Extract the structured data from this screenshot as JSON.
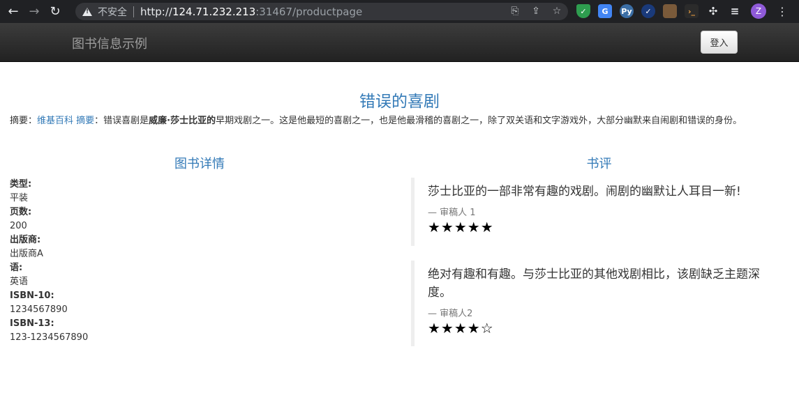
{
  "browser": {
    "back": "←",
    "forward": "→",
    "reload": "↻",
    "security_label": "不安全",
    "url_scheme": "http://",
    "url_host": "124.71.232.213",
    "url_rest": ":31467/productpage",
    "profile_initial": "Z"
  },
  "navbar": {
    "brand": "图书信息示例",
    "login_label": "登入"
  },
  "book": {
    "title": "错误的喜剧",
    "summary_prefix": "摘要：",
    "summary_link": "维基百科 摘要",
    "summary_colon": "：错误喜剧是",
    "summary_bold": "威廉·莎士比亚的",
    "summary_rest": "早期戏剧之一。这是他最短的喜剧之一，也是他最滑稽的喜剧之一，除了双关语和文字游戏外，大部分幽默来自闹剧和错误的身份。"
  },
  "details": {
    "heading": "图书详情",
    "fields": [
      {
        "label": "类型:",
        "value": "平装"
      },
      {
        "label": "页数:",
        "value": "200"
      },
      {
        "label": "出版商:",
        "value": "出版商A"
      },
      {
        "label": "语:",
        "value": "英语"
      },
      {
        "label": "ISBN-10:",
        "value": "1234567890"
      },
      {
        "label": "ISBN-13:",
        "value": "123-1234567890"
      }
    ]
  },
  "reviews": {
    "heading": "书评",
    "items": [
      {
        "text": "莎士比亚的一部非常有趣的戏剧。闹剧的幽默让人耳目一新!",
        "author": "— 审稿人 1",
        "stars": "★★★★★",
        "rating": 5
      },
      {
        "text": "绝对有趣和有趣。与莎士比亚的其他戏剧相比，该剧缺乏主题深度。",
        "author": "— 审稿人2",
        "stars": "★★★★☆",
        "rating": 4
      }
    ]
  }
}
